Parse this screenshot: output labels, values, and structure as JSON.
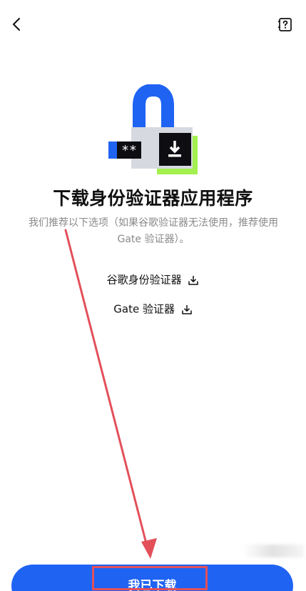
{
  "title": "下载身份验证器应用程序",
  "description": "我们推荐以下选项（如果谷歌验证器无法使用，推荐使用 Gate 验证器）。",
  "links": {
    "google": "谷歌身份验证器",
    "gate": "Gate 验证器"
  },
  "illustration": {
    "password_mask": "**"
  },
  "confirm_button": "我已下载",
  "colors": {
    "accent": "#1f63f3",
    "lime": "#a3f04f",
    "annotation": "#e3505a"
  },
  "icons": [
    "back-icon",
    "help-icon",
    "download-icon"
  ]
}
